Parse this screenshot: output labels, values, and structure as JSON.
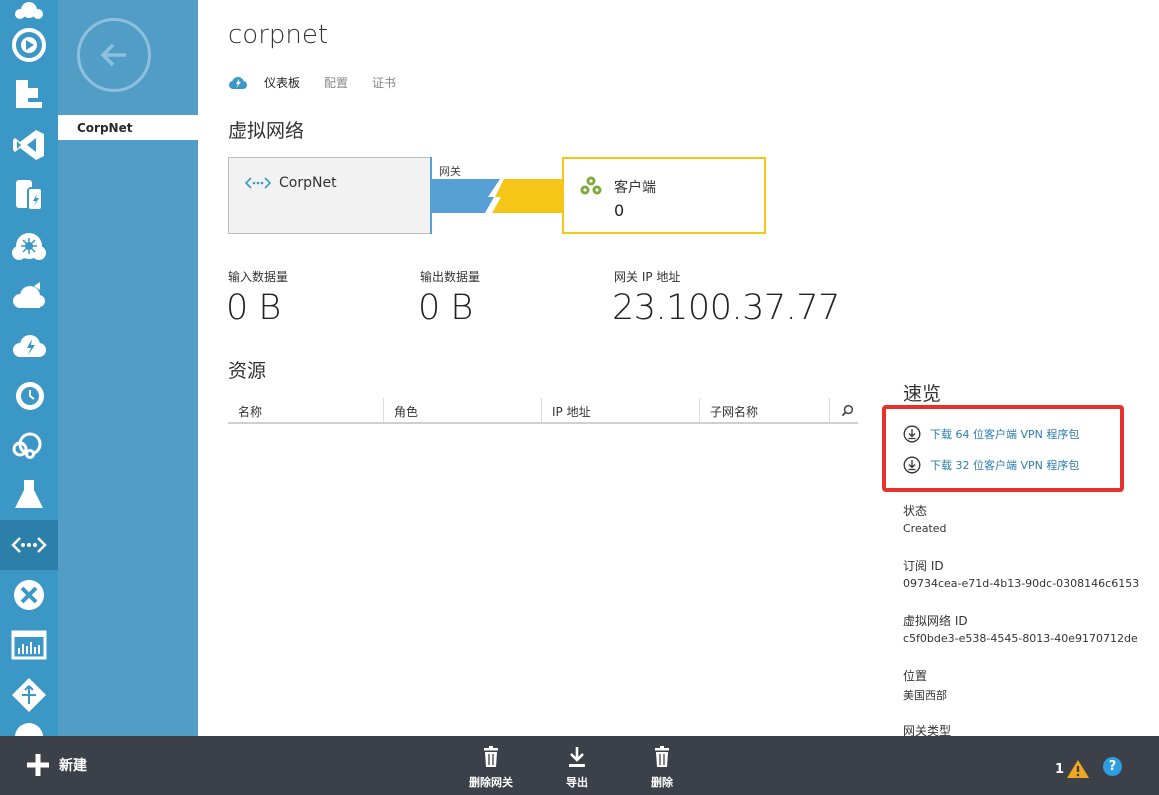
{
  "nav_icons": [
    "cloud-services-icon",
    "media-services-icon",
    "websites-icon",
    "visual-studio-icon",
    "storage-icon",
    "hdinsight-icon",
    "cloud-upload-icon",
    "mobile-services-icon",
    "scheduler-icon",
    "cloud-settings-icon",
    "lab-flask-icon",
    "virtual-network-icon",
    "recovery-services-icon",
    "dashboard-icon",
    "traffic-manager-icon"
  ],
  "list": {
    "item": "CorpNet"
  },
  "header": {
    "title": "corpnet"
  },
  "tabs": [
    "仪表板",
    "配置",
    "证书"
  ],
  "vnet": {
    "heading": "虚拟网络",
    "network_label": "CorpNet",
    "gateway_label": "网关",
    "client_label": "客户端",
    "client_count": "0"
  },
  "stats": [
    {
      "label": "输入数据量",
      "value": "0 B"
    },
    {
      "label": "输出数据量",
      "value": "0 B"
    },
    {
      "label": "网关 IP 地址",
      "value": "23.100.37.77"
    }
  ],
  "resources": {
    "heading": "资源",
    "columns": [
      "名称",
      "角色",
      "IP 地址",
      "子网名称"
    ]
  },
  "quick_glance": {
    "heading": "速览",
    "downloads": [
      "下载 64 位客户端 VPN 程序包",
      "下载 32 位客户端 VPN 程序包"
    ],
    "props": [
      {
        "label": "状态",
        "value": "Created"
      },
      {
        "label": "订阅 ID",
        "value": "09734cea-e71d-4b13-90dc-0308146c6153"
      },
      {
        "label": "虚拟网络 ID",
        "value": "c5f0bde3-e538-4545-8013-40e9170712de"
      },
      {
        "label": "位置",
        "value": "美国西部"
      },
      {
        "label": "网关类型",
        "value": ""
      }
    ]
  },
  "commandbar": {
    "new_label": "新建",
    "delete_gateway": "删除网关",
    "export": "导出",
    "delete": "删除",
    "notification_count": "1",
    "help": "?"
  },
  "colors": {
    "nav_bg": "#3b98c6",
    "list_bg": "#519dc6",
    "gateway_blue": "#56a0d3",
    "gateway_yellow": "#f5c518",
    "highlight": "#e8312a",
    "cmdbar_bg": "#3c4149"
  }
}
